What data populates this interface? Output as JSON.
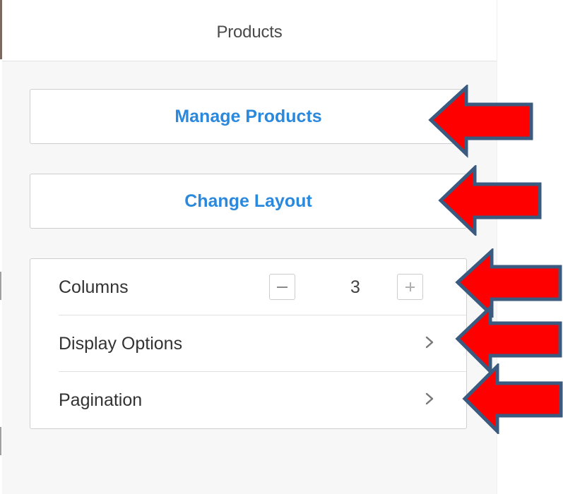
{
  "panel": {
    "title": "Products"
  },
  "actions": {
    "manage_products_label": "Manage Products",
    "change_layout_label": "Change Layout"
  },
  "settings": {
    "columns": {
      "label": "Columns",
      "value": "3",
      "decrement_icon": "minus-icon",
      "increment_icon": "plus-icon"
    },
    "display_options": {
      "label": "Display Options",
      "icon": "chevron-right-icon"
    },
    "pagination": {
      "label": "Pagination",
      "icon": "chevron-right-icon"
    }
  },
  "colors": {
    "accent_link": "#2a88dd",
    "annotation_arrow_fill": "#ff0000",
    "annotation_arrow_stroke": "#3a5a80",
    "panel_background": "#f7f7f7"
  },
  "annotations": {
    "arrow_icon": "red-arrow-left-icon",
    "count": 5
  }
}
